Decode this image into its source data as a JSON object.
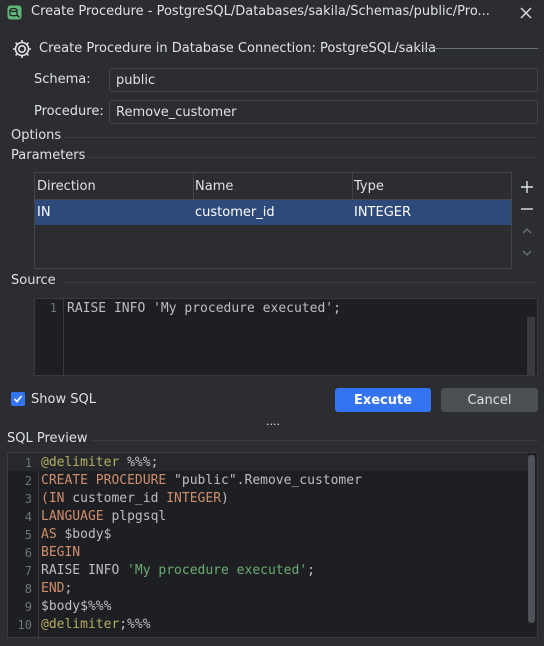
{
  "window": {
    "title": "Create Procedure - PostgreSQL/Databases/sakila/Schemas/public/Pro..."
  },
  "header": {
    "text": "Create Procedure in Database Connection: PostgreSQL/sakila"
  },
  "form": {
    "schema_label": "Schema:",
    "schema_value": "public",
    "procedure_label": "Procedure:",
    "procedure_value": "Remove_customer"
  },
  "sections": {
    "options": "Options",
    "parameters": "Parameters",
    "source": "Source",
    "sql_preview": "SQL Preview"
  },
  "parameters_table": {
    "columns": [
      "Direction",
      "Name",
      "Type"
    ],
    "rows": [
      [
        "IN",
        "customer_id",
        "INTEGER"
      ]
    ],
    "buttons": {
      "add": "+",
      "remove": "−"
    }
  },
  "source_editor": {
    "lines": [
      {
        "num": "1",
        "text": "RAISE INFO 'My procedure executed';"
      }
    ]
  },
  "actions": {
    "show_sql_label": "Show SQL",
    "show_sql_checked": true,
    "execute_label": "Execute",
    "cancel_label": "Cancel",
    "splitter": "...."
  },
  "sql_preview": {
    "lines": [
      {
        "num": "1",
        "tokens": [
          [
            "ann",
            "@delimiter"
          ],
          [
            "",
            " %%%;"
          ]
        ]
      },
      {
        "num": "2",
        "tokens": [
          [
            "kw",
            "CREATE PROCEDURE"
          ],
          [
            "",
            " \"public\".Remove_customer"
          ]
        ]
      },
      {
        "num": "3",
        "tokens": [
          [
            "kw",
            "(IN"
          ],
          [
            "",
            " customer_id "
          ],
          [
            "kw",
            "INTEGER"
          ],
          [
            "",
            ")"
          ]
        ]
      },
      {
        "num": "4",
        "tokens": [
          [
            "kw",
            "LANGUAGE"
          ],
          [
            "",
            " plpgsql"
          ]
        ]
      },
      {
        "num": "5",
        "tokens": [
          [
            "kw",
            "AS"
          ],
          [
            "",
            " $body$"
          ]
        ]
      },
      {
        "num": "6",
        "tokens": [
          [
            "kw",
            "BEGIN"
          ]
        ]
      },
      {
        "num": "7",
        "tokens": [
          [
            "",
            "RAISE INFO "
          ],
          [
            "str",
            "'My procedure executed'"
          ],
          [
            "",
            ";"
          ]
        ]
      },
      {
        "num": "8",
        "tokens": [
          [
            "kw",
            "END"
          ],
          [
            "",
            ";"
          ]
        ]
      },
      {
        "num": "9",
        "tokens": [
          [
            "",
            "$body$%%%"
          ]
        ]
      },
      {
        "num": "10",
        "tokens": [
          [
            "ann",
            "@delimiter"
          ],
          [
            "",
            ";%%%"
          ]
        ]
      }
    ]
  },
  "colors": {
    "background": "#2b2d30",
    "accent": "#3574f0",
    "selection": "#2e4a7a",
    "keyword": "#cf8e6d",
    "string": "#6aab73"
  }
}
